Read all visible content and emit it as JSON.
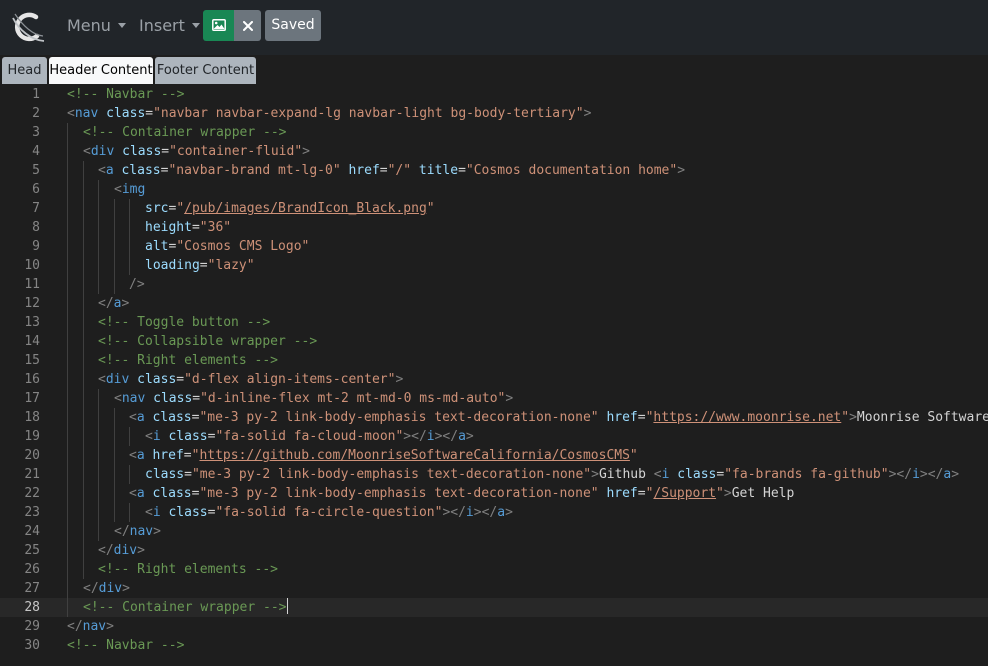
{
  "toolbar": {
    "logo": "cosmos-logo-icon",
    "menu_label": "Menu",
    "insert_label": "Insert",
    "image_icon": "image-icon",
    "close_icon": "close-icon",
    "saved_label": "Saved",
    "colors": {
      "bar": "#212529",
      "image_btn": "#198754",
      "secondary": "#6c757d"
    }
  },
  "tabs": [
    {
      "label": "Head",
      "active": false
    },
    {
      "label": "Header Content",
      "active": true
    },
    {
      "label": "Footer Content",
      "active": false
    }
  ],
  "editor": {
    "current_line": 28,
    "lines": [
      {
        "n": "1",
        "indent": 0,
        "tokens": [
          [
            "c",
            "<!-- Navbar -->"
          ]
        ]
      },
      {
        "n": "2",
        "indent": 0,
        "tokens": [
          [
            "br",
            "<"
          ],
          [
            "tag",
            "nav"
          ],
          [
            "tx",
            " "
          ],
          [
            "at",
            "class"
          ],
          [
            "tx",
            "="
          ],
          [
            "s",
            "\"navbar navbar-expand-lg navbar-light bg-body-tertiary\""
          ],
          [
            "br",
            ">"
          ]
        ]
      },
      {
        "n": "3",
        "indent": 1,
        "tokens": [
          [
            "c",
            "<!-- Container wrapper -->"
          ]
        ]
      },
      {
        "n": "4",
        "indent": 1,
        "tokens": [
          [
            "br",
            "<"
          ],
          [
            "tag",
            "div"
          ],
          [
            "tx",
            " "
          ],
          [
            "at",
            "class"
          ],
          [
            "tx",
            "="
          ],
          [
            "s",
            "\"container-fluid\""
          ],
          [
            "br",
            ">"
          ]
        ]
      },
      {
        "n": "5",
        "indent": 2,
        "tokens": [
          [
            "br",
            "<"
          ],
          [
            "tag",
            "a"
          ],
          [
            "tx",
            " "
          ],
          [
            "at",
            "class"
          ],
          [
            "tx",
            "="
          ],
          [
            "s",
            "\"navbar-brand mt-lg-0\""
          ],
          [
            "tx",
            " "
          ],
          [
            "at",
            "href"
          ],
          [
            "tx",
            "="
          ],
          [
            "s",
            "\"/\""
          ],
          [
            "tx",
            " "
          ],
          [
            "at",
            "title"
          ],
          [
            "tx",
            "="
          ],
          [
            "s",
            "\"Cosmos documentation home\""
          ],
          [
            "br",
            ">"
          ]
        ]
      },
      {
        "n": "6",
        "indent": 3,
        "tokens": [
          [
            "br",
            "<"
          ],
          [
            "tag",
            "img"
          ]
        ]
      },
      {
        "n": "7",
        "indent": 5,
        "tokens": [
          [
            "at",
            "src"
          ],
          [
            "tx",
            "="
          ],
          [
            "s",
            "\""
          ],
          [
            "url",
            "/pub/images/BrandIcon_Black.png"
          ],
          [
            "s",
            "\""
          ]
        ]
      },
      {
        "n": "8",
        "indent": 5,
        "tokens": [
          [
            "at",
            "height"
          ],
          [
            "tx",
            "="
          ],
          [
            "s",
            "\"36\""
          ]
        ]
      },
      {
        "n": "9",
        "indent": 5,
        "tokens": [
          [
            "at",
            "alt"
          ],
          [
            "tx",
            "="
          ],
          [
            "s",
            "\"Cosmos CMS Logo\""
          ]
        ]
      },
      {
        "n": "10",
        "indent": 5,
        "tokens": [
          [
            "at",
            "loading"
          ],
          [
            "tx",
            "="
          ],
          [
            "s",
            "\"lazy\""
          ]
        ]
      },
      {
        "n": "11",
        "indent": 4,
        "tokens": [
          [
            "br",
            "/>"
          ]
        ]
      },
      {
        "n": "12",
        "indent": 2,
        "tokens": [
          [
            "br",
            "</"
          ],
          [
            "tag",
            "a"
          ],
          [
            "br",
            ">"
          ]
        ]
      },
      {
        "n": "13",
        "indent": 2,
        "tokens": [
          [
            "c",
            "<!-- Toggle button -->"
          ]
        ]
      },
      {
        "n": "14",
        "indent": 2,
        "tokens": [
          [
            "c",
            "<!-- Collapsible wrapper -->"
          ]
        ]
      },
      {
        "n": "15",
        "indent": 2,
        "tokens": [
          [
            "c",
            "<!-- Right elements -->"
          ]
        ]
      },
      {
        "n": "16",
        "indent": 2,
        "tokens": [
          [
            "br",
            "<"
          ],
          [
            "tag",
            "div"
          ],
          [
            "tx",
            " "
          ],
          [
            "at",
            "class"
          ],
          [
            "tx",
            "="
          ],
          [
            "s",
            "\"d-flex align-items-center\""
          ],
          [
            "br",
            ">"
          ]
        ]
      },
      {
        "n": "17",
        "indent": 3,
        "tokens": [
          [
            "br",
            "<"
          ],
          [
            "tag",
            "nav"
          ],
          [
            "tx",
            " "
          ],
          [
            "at",
            "class"
          ],
          [
            "tx",
            "="
          ],
          [
            "s",
            "\"d-inline-flex mt-2 mt-md-0 ms-md-auto\""
          ],
          [
            "br",
            ">"
          ]
        ]
      },
      {
        "n": "18",
        "indent": 4,
        "tokens": [
          [
            "br",
            "<"
          ],
          [
            "tag",
            "a"
          ],
          [
            "tx",
            " "
          ],
          [
            "at",
            "class"
          ],
          [
            "tx",
            "="
          ],
          [
            "s",
            "\"me-3 py-2 link-body-emphasis text-decoration-none\""
          ],
          [
            "tx",
            " "
          ],
          [
            "at",
            "href"
          ],
          [
            "tx",
            "="
          ],
          [
            "s",
            "\""
          ],
          [
            "url",
            "https://www.moonrise.net"
          ],
          [
            "s",
            "\""
          ],
          [
            "br",
            ">"
          ],
          [
            "tx",
            "Moonrise Software"
          ]
        ]
      },
      {
        "n": "19",
        "indent": 5,
        "tokens": [
          [
            "br",
            "<"
          ],
          [
            "tag",
            "i"
          ],
          [
            "tx",
            " "
          ],
          [
            "at",
            "class"
          ],
          [
            "tx",
            "="
          ],
          [
            "s",
            "\"fa-solid fa-cloud-moon\""
          ],
          [
            "br",
            "></"
          ],
          [
            "tag",
            "i"
          ],
          [
            "br",
            "></"
          ],
          [
            "tag",
            "a"
          ],
          [
            "br",
            ">"
          ]
        ]
      },
      {
        "n": "20",
        "indent": 4,
        "tokens": [
          [
            "br",
            "<"
          ],
          [
            "tag",
            "a"
          ],
          [
            "tx",
            " "
          ],
          [
            "at",
            "href"
          ],
          [
            "tx",
            "="
          ],
          [
            "s",
            "\""
          ],
          [
            "url",
            "https://github.com/MoonriseSoftwareCalifornia/CosmosCMS"
          ],
          [
            "s",
            "\""
          ]
        ]
      },
      {
        "n": "21",
        "indent": 5,
        "tokens": [
          [
            "at",
            "class"
          ],
          [
            "tx",
            "="
          ],
          [
            "s",
            "\"me-3 py-2 link-body-emphasis text-decoration-none\""
          ],
          [
            "br",
            ">"
          ],
          [
            "tx",
            "Github "
          ],
          [
            "br",
            "<"
          ],
          [
            "tag",
            "i"
          ],
          [
            "tx",
            " "
          ],
          [
            "at",
            "class"
          ],
          [
            "tx",
            "="
          ],
          [
            "s",
            "\"fa-brands fa-github\""
          ],
          [
            "br",
            "></"
          ],
          [
            "tag",
            "i"
          ],
          [
            "br",
            "></"
          ],
          [
            "tag",
            "a"
          ],
          [
            "br",
            ">"
          ]
        ]
      },
      {
        "n": "22",
        "indent": 4,
        "tokens": [
          [
            "br",
            "<"
          ],
          [
            "tag",
            "a"
          ],
          [
            "tx",
            " "
          ],
          [
            "at",
            "class"
          ],
          [
            "tx",
            "="
          ],
          [
            "s",
            "\"me-3 py-2 link-body-emphasis text-decoration-none\""
          ],
          [
            "tx",
            " "
          ],
          [
            "at",
            "href"
          ],
          [
            "tx",
            "="
          ],
          [
            "s",
            "\""
          ],
          [
            "url",
            "/Support"
          ],
          [
            "s",
            "\""
          ],
          [
            "br",
            ">"
          ],
          [
            "tx",
            "Get Help"
          ]
        ]
      },
      {
        "n": "23",
        "indent": 5,
        "tokens": [
          [
            "br",
            "<"
          ],
          [
            "tag",
            "i"
          ],
          [
            "tx",
            " "
          ],
          [
            "at",
            "class"
          ],
          [
            "tx",
            "="
          ],
          [
            "s",
            "\"fa-solid fa-circle-question\""
          ],
          [
            "br",
            "></"
          ],
          [
            "tag",
            "i"
          ],
          [
            "br",
            "></"
          ],
          [
            "tag",
            "a"
          ],
          [
            "br",
            ">"
          ]
        ]
      },
      {
        "n": "24",
        "indent": 3,
        "tokens": [
          [
            "br",
            "</"
          ],
          [
            "tag",
            "nav"
          ],
          [
            "br",
            ">"
          ]
        ]
      },
      {
        "n": "25",
        "indent": 2,
        "tokens": [
          [
            "br",
            "</"
          ],
          [
            "tag",
            "div"
          ],
          [
            "br",
            ">"
          ]
        ]
      },
      {
        "n": "26",
        "indent": 2,
        "tokens": [
          [
            "c",
            "<!-- Right elements -->"
          ]
        ]
      },
      {
        "n": "27",
        "indent": 1,
        "tokens": [
          [
            "br",
            "</"
          ],
          [
            "tag",
            "div"
          ],
          [
            "br",
            ">"
          ]
        ]
      },
      {
        "n": "28",
        "indent": 1,
        "tokens": [
          [
            "c",
            "<!-- Container wrapper -->"
          ]
        ]
      },
      {
        "n": "29",
        "indent": 0,
        "tokens": [
          [
            "br",
            "</"
          ],
          [
            "tag",
            "nav"
          ],
          [
            "br",
            ">"
          ]
        ]
      },
      {
        "n": "30",
        "indent": 0,
        "tokens": [
          [
            "c",
            "<!-- Navbar -->"
          ]
        ]
      }
    ]
  }
}
